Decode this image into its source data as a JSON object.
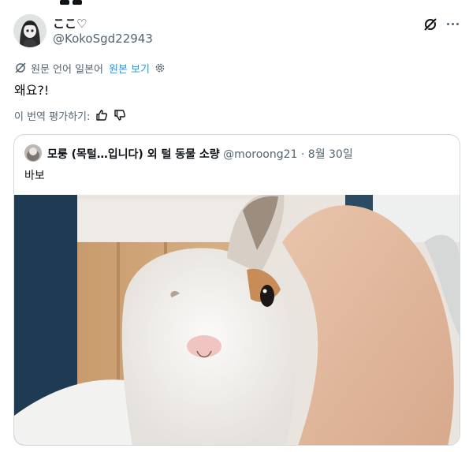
{
  "author": {
    "display_name": "ここ♡",
    "handle": "@KokoSgd22943"
  },
  "translation": {
    "label": "원문 언어 일본어",
    "show_original": "원본 보기"
  },
  "tweet": {
    "text": "왜요?!"
  },
  "rating": {
    "label": "이 번역 평가하기:"
  },
  "quoted": {
    "name": "모룽 (목털…입니다) 외 털 동물 소량",
    "handle": "@moroong21",
    "separator": "·",
    "date": "8월 30일",
    "text": "바보"
  },
  "colors": {
    "text": "#0f1419",
    "secondary": "#536471",
    "link": "#1d9bf0",
    "border": "#cfd9de"
  },
  "icons": [
    "grok-slash-icon",
    "more-icon",
    "translate-icon",
    "gear-icon",
    "thumbs-up-icon",
    "thumbs-down-icon"
  ]
}
